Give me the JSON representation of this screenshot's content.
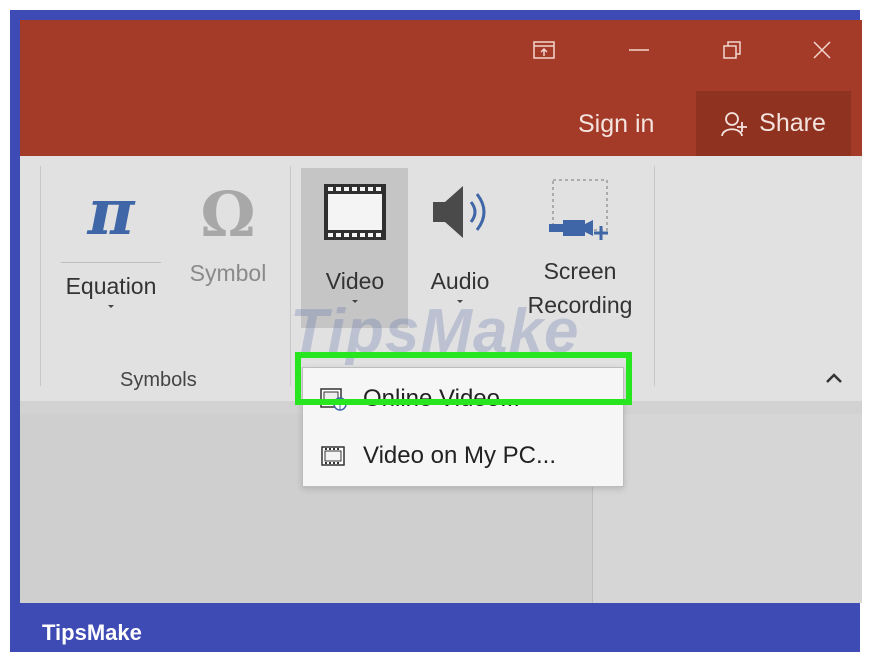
{
  "window": {
    "signin_label": "Sign in",
    "share_label": "Share"
  },
  "ribbon": {
    "tools": {
      "equation": "Equation",
      "symbol": "Symbol",
      "video": "Video",
      "audio": "Audio",
      "screen_recording_line1": "Screen",
      "screen_recording_line2": "Recording"
    },
    "group_label": "Symbols"
  },
  "video_menu": {
    "items": [
      {
        "label": "Online Video...",
        "mnemonic": "O",
        "icon": "online-video-icon"
      },
      {
        "label": "Video on My PC...",
        "mnemonic": "P",
        "icon": "film-icon"
      }
    ]
  },
  "watermark": "TipsMake",
  "brand": "TipsMake",
  "colors": {
    "title_bar": "#a33b28",
    "ribbon": "#e1e1e1",
    "highlight": "#27e620",
    "brand_bar": "#3f4bb5"
  }
}
